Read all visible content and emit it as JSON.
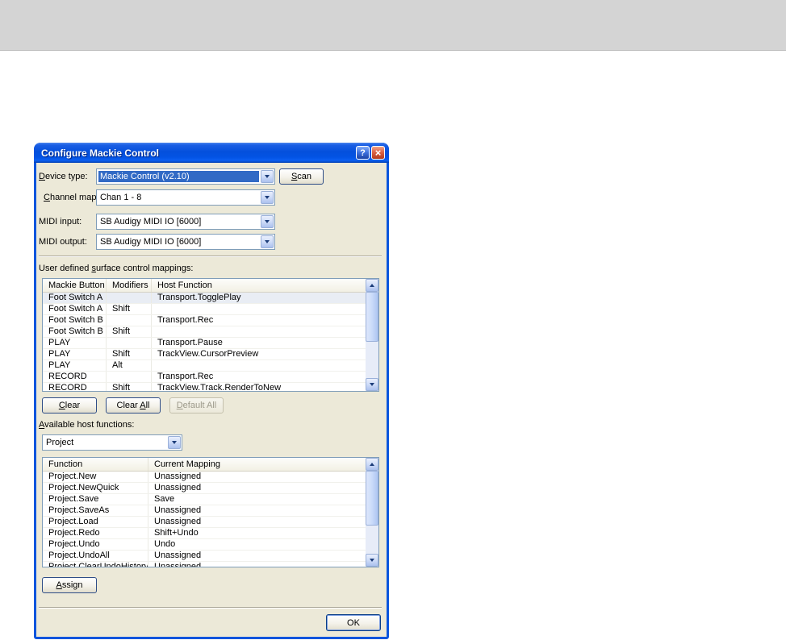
{
  "window": {
    "title": "Configure Mackie Control",
    "help_glyph": "?",
    "close_glyph": "×"
  },
  "colors": {
    "titlebar_blue": "#0054e3",
    "selection_blue": "#316ac5",
    "client_beige": "#ece9d8"
  },
  "device": {
    "label": "Device type:",
    "value": "Mackie Control (v2.10)",
    "scan_label": "Scan"
  },
  "channel_mapping": {
    "label": "Channel mapping:",
    "value": "Chan 1 - 8"
  },
  "midi_input": {
    "label": "MIDI input:",
    "value": "SB Audigy MIDI IO [6000]"
  },
  "midi_output": {
    "label": "MIDI output:",
    "value": "SB Audigy MIDI IO [6000]"
  },
  "mappings": {
    "label": "User defined surface control mappings:",
    "columns": [
      "Mackie Button",
      "Modifiers",
      "Host Function"
    ],
    "rows": [
      [
        "Foot Switch A",
        "",
        "Transport.TogglePlay"
      ],
      [
        "Foot Switch A",
        "Shift",
        ""
      ],
      [
        "Foot Switch B",
        "",
        "Transport.Rec"
      ],
      [
        "Foot Switch B",
        "Shift",
        ""
      ],
      [
        "PLAY",
        "",
        "Transport.Pause"
      ],
      [
        "PLAY",
        "Shift",
        "TrackView.CursorPreview"
      ],
      [
        "PLAY",
        "Alt",
        ""
      ],
      [
        "RECORD",
        "",
        "Transport.Rec"
      ],
      [
        "RECORD",
        "Shift",
        "TrackView.Track.RenderToNew"
      ]
    ],
    "clear_label": "Clear",
    "clear_all_label": "Clear All",
    "default_all_label": "Default All"
  },
  "host_functions": {
    "label": "Available host functions:",
    "category_value": "Project",
    "columns": [
      "Function",
      "Current Mapping"
    ],
    "rows": [
      [
        "Project.New",
        "Unassigned"
      ],
      [
        "Project.NewQuick",
        "Unassigned"
      ],
      [
        "Project.Save",
        "Save"
      ],
      [
        "Project.SaveAs",
        "Unassigned"
      ],
      [
        "Project.Load",
        "Unassigned"
      ],
      [
        "Project.Redo",
        "Shift+Undo"
      ],
      [
        "Project.Undo",
        "Undo"
      ],
      [
        "Project.UndoAll",
        "Unassigned"
      ],
      [
        "Project.ClearUndoHistory",
        "Unassigned"
      ]
    ],
    "assign_label": "Assign"
  },
  "ok_label": "OK"
}
